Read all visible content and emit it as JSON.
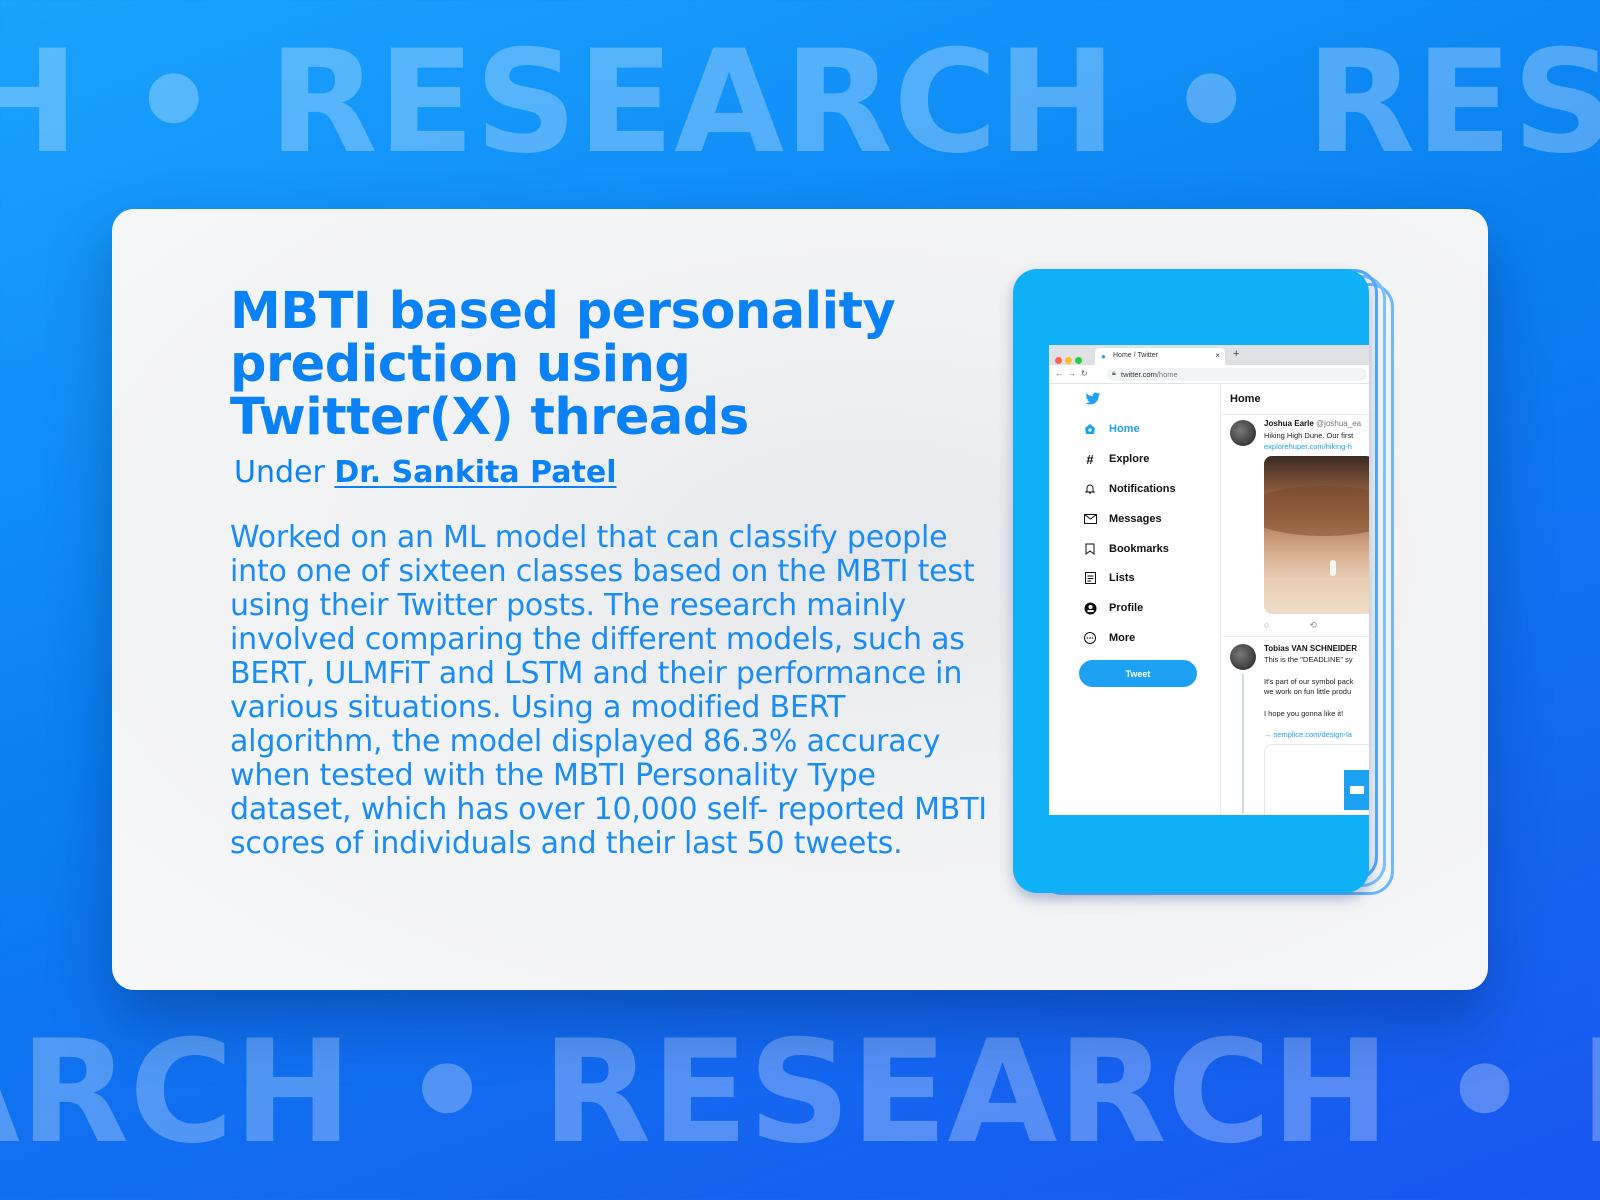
{
  "background": {
    "top_text": "H • RESEARCH • RESEARCH • RESEA",
    "bottom_text": "ARCH • RESEARCH • RESEARCH • RES"
  },
  "project": {
    "title": "MBTI based personality prediction using Twitter(X) threads",
    "under_label": "Under",
    "advisor": "Dr. Sankita Patel",
    "description": "Worked on an ML model that can classify people into one of sixteen classes based on the MBTI test using their Twitter posts. The research mainly involved comparing the different models, such as BERT, ULMFiT and LSTM and their performance in various situations. Using a modified BERT algorithm, the model displayed 86.3% accuracy when tested with the MBTI Personality Type dataset, which has over 10,000 self- reported MBTI scores of individuals and their last 50 tweets."
  },
  "mockup": {
    "tab_title": "Home / Twitter",
    "url_host": "twitter.com",
    "url_path": "/home",
    "menu": [
      {
        "label": "Home",
        "icon": "home-icon"
      },
      {
        "label": "Explore",
        "icon": "hashtag-icon"
      },
      {
        "label": "Notifications",
        "icon": "bell-icon"
      },
      {
        "label": "Messages",
        "icon": "mail-icon"
      },
      {
        "label": "Bookmarks",
        "icon": "bookmark-icon"
      },
      {
        "label": "Lists",
        "icon": "list-icon"
      },
      {
        "label": "Profile",
        "icon": "profile-icon"
      },
      {
        "label": "More",
        "icon": "more-icon"
      }
    ],
    "tweet_button": "Tweet",
    "feed_title": "Home",
    "tweets": [
      {
        "name": "Joshua Earle",
        "handle": "@joshua_ea",
        "line1": "Hiking High Dune. Our first",
        "link": "explorehuper.com/hiking-h"
      },
      {
        "name": "Tobias VAN SCHNEIDER",
        "line1": "This is the \"DEADLINE\" sy",
        "line2": "It's part of our symbol pack",
        "line3": "we work on fun little produ",
        "line4": "I hope you gonna like it!",
        "link": "→ semplice.com/design-la"
      }
    ]
  }
}
